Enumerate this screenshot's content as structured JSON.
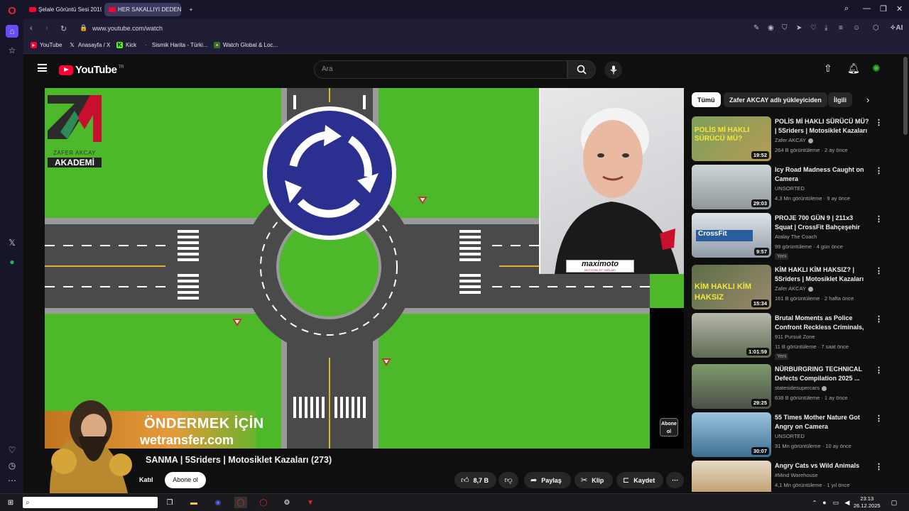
{
  "browser": {
    "tabs": [
      {
        "label": "Şelale Görüntü Sesi 2019",
        "active": false
      },
      {
        "label": "HER SAKALLIYI DEDEN SA",
        "active": true
      }
    ],
    "new_tab": "+",
    "url": "www.youtube.com/watch",
    "ai_label": "AI",
    "bookmarks": [
      "YouTube",
      "Anasayfa / X",
      "Kick",
      "Sismik Harita - Türki...",
      "Watch Global & Loc..."
    ]
  },
  "youtube": {
    "logo_text": "YouTube",
    "country_code": "TR",
    "search_placeholder": "Ara",
    "video": {
      "sign_brand_line1": "ZAFER AKCAY",
      "sign_brand_line2": "AKADEMİ",
      "overlay_line1": "ÖNDERMEK İÇİN",
      "overlay_line2": "wetransfer.com",
      "presenter_brand": "maximoto",
      "presenter_brand_sub": "MOTOSİKLET YAĞLARI",
      "abone_badge": "Abone ol"
    },
    "title": "SANMA | 5Sriders | Motosiklet Kazaları (273)",
    "join_label": "Katıl",
    "subscribe_label": "Abone ol",
    "actions": {
      "likes": "8,7 B",
      "share": "Paylaş",
      "clip": "Klip",
      "save": "Kaydet",
      "more": "⋯"
    },
    "chips": [
      "Tümü",
      "Zafer AKCAY adlı yükleyiciden",
      "İlgili"
    ],
    "recommendations": [
      {
        "title": "POLİS Mİ HAKLI SÜRÜCÜ MÜ? | 5Sriders | Motosiklet Kazaları ...",
        "channel": "Zafer AKCAY",
        "verified": true,
        "meta": "264 B görüntüleme · 2 ay önce",
        "duration": "19:52",
        "thumb_text": "POLİS Mİ HAKLI SÜRÜCÜ MÜ?",
        "badge": ""
      },
      {
        "title": "Icy Road Madness Caught on Camera",
        "channel": "UNSORTED",
        "verified": false,
        "meta": "4,3 Mn görüntüleme · 9 ay önce",
        "duration": "29:03",
        "thumb_text": "",
        "badge": ""
      },
      {
        "title": "PROJE 700 GÜN 9 | 211x3 Squat | CrossFit Bahçeşehir",
        "channel": "Atalay The Coach",
        "verified": false,
        "meta": "99 görüntüleme · 4 gün önce",
        "duration": "9:57",
        "thumb_text": "CrossFit",
        "badge": "Yeni"
      },
      {
        "title": "KİM HAKLI KİM HAKSIZ? | 5Sriders | Motosiklet Kazaları ...",
        "channel": "Zafer AKCAY",
        "verified": true,
        "meta": "161 B görüntüleme · 2 hafta önce",
        "duration": "15:34",
        "thumb_text": "KİM HAKLI KİM HAKSIZ",
        "badge": ""
      },
      {
        "title": "Brutal Moments as Police Confront Reckless Criminals, ...",
        "channel": "911 Pursuit Zone",
        "verified": false,
        "meta": "11 B görüntüleme · 7 saat önce",
        "duration": "1:01:59",
        "thumb_text": "",
        "badge": "Yeni"
      },
      {
        "title": "NÜRBURGRING TECHNICAL Defects Compilation 2025 ...",
        "channel": "statesidesupercars",
        "verified": true,
        "meta": "638 B görüntüleme · 1 ay önce",
        "duration": "29:25",
        "thumb_text": "",
        "badge": ""
      },
      {
        "title": "55 Times Mother Nature Got Angry on Camera",
        "channel": "UNSORTED",
        "verified": false,
        "meta": "31 Mn görüntüleme · 10 ay önce",
        "duration": "30:07",
        "thumb_text": "",
        "badge": ""
      },
      {
        "title": "Angry Cats vs Wild Animals",
        "channel": "#Mind Warehouse",
        "verified": false,
        "meta": "4,1 Mn görüntüleme · 1 yıl önce",
        "duration": "",
        "thumb_text": "",
        "badge": ""
      }
    ]
  },
  "taskbar": {
    "time": "23:13",
    "date": "26.12.2025"
  },
  "colors": {
    "yt_red": "#ff0033",
    "opera_red": "#e5252b",
    "grass": "#4db82a",
    "road": "#4a4a4a",
    "sign_blue": "#2b2f8f"
  }
}
